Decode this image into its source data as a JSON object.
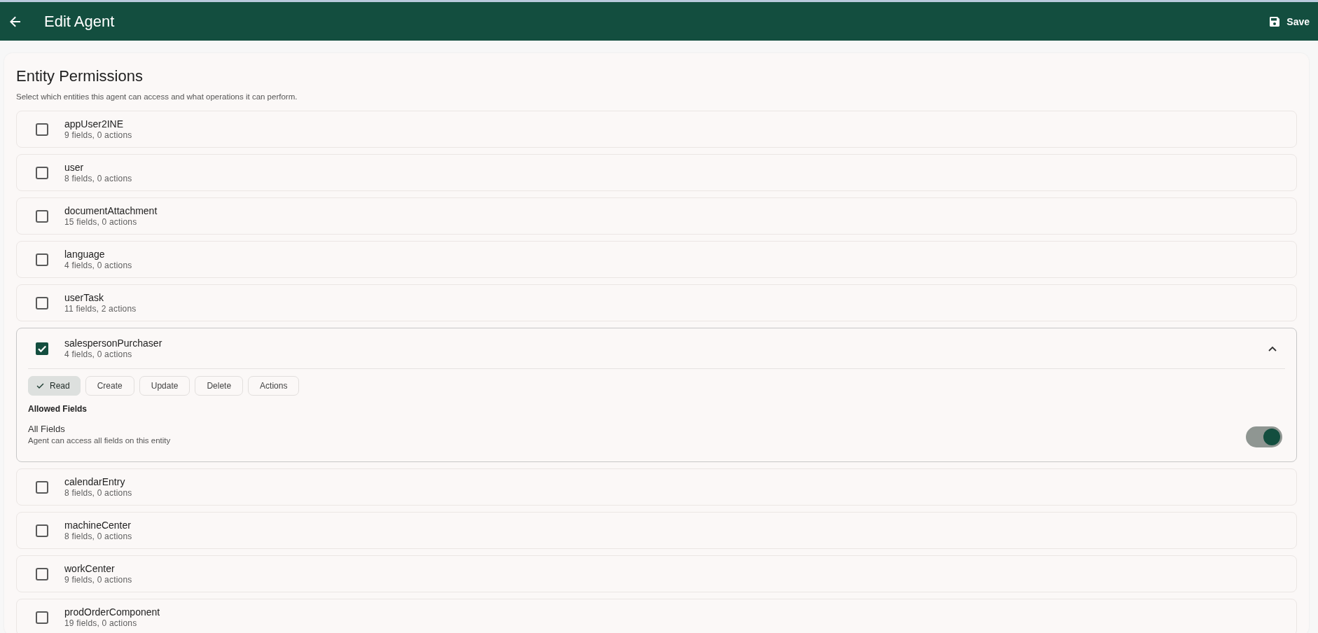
{
  "header": {
    "title": "Edit Agent",
    "save_label": "Save"
  },
  "section": {
    "title": "Entity Permissions",
    "description": "Select which entities this agent can access and what operations it can perform."
  },
  "entities": [
    {
      "name": "appUser2INE",
      "summary": "9 fields, 0 actions",
      "checked": false,
      "expanded": false
    },
    {
      "name": "user",
      "summary": "8 fields, 0 actions",
      "checked": false,
      "expanded": false
    },
    {
      "name": "documentAttachment",
      "summary": "15 fields, 0 actions",
      "checked": false,
      "expanded": false
    },
    {
      "name": "language",
      "summary": "4 fields, 0 actions",
      "checked": false,
      "expanded": false
    },
    {
      "name": "userTask",
      "summary": "11 fields, 2 actions",
      "checked": false,
      "expanded": false
    },
    {
      "name": "salespersonPurchaser",
      "summary": "4 fields, 0 actions",
      "checked": true,
      "expanded": true,
      "operations": [
        {
          "label": "Read",
          "selected": true
        },
        {
          "label": "Create",
          "selected": false
        },
        {
          "label": "Update",
          "selected": false
        },
        {
          "label": "Delete",
          "selected": false
        },
        {
          "label": "Actions",
          "selected": false
        }
      ],
      "allowed_fields": {
        "heading": "Allowed Fields",
        "label": "All Fields",
        "description": "Agent can access all fields on this entity",
        "on": true
      }
    },
    {
      "name": "calendarEntry",
      "summary": "8 fields, 0 actions",
      "checked": false,
      "expanded": false
    },
    {
      "name": "machineCenter",
      "summary": "8 fields, 0 actions",
      "checked": false,
      "expanded": false
    },
    {
      "name": "workCenter",
      "summary": "9 fields, 0 actions",
      "checked": false,
      "expanded": false
    },
    {
      "name": "prodOrderComponent",
      "summary": "19 fields, 0 actions",
      "checked": false,
      "expanded": false
    }
  ]
}
